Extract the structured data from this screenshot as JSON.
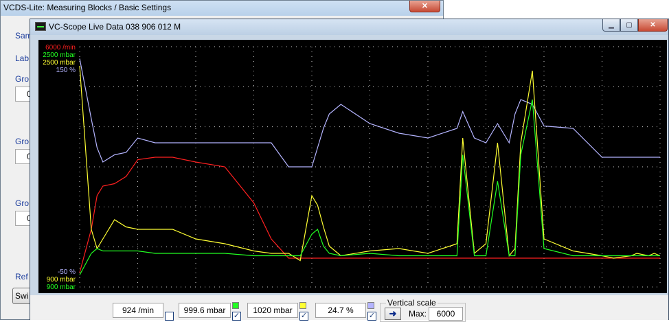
{
  "background_window": {
    "title": "VCDS-Lite: Measuring Blocks / Basic Settings",
    "close_label": "✕",
    "labels": [
      "Sam",
      "Lab",
      "Gro",
      "Gro",
      "Gro",
      "Ref"
    ],
    "boxes": [
      "0",
      "0",
      "0"
    ],
    "switch_button": "Swi"
  },
  "scope_window": {
    "title": "VC-Scope   Live Data   038 906 012 M",
    "minimize": "▁",
    "maximize": "▢",
    "close": "✕"
  },
  "chart_data": {
    "type": "line",
    "background": "#000000",
    "grid": true,
    "grid_color": "#c8c8c8",
    "y_scale_top": [
      {
        "text": "6000 /min",
        "color": "#ff2020"
      },
      {
        "text": "2500 mbar",
        "color": "#22ff22"
      },
      {
        "text": "2500 mbar",
        "color": "#ffff33"
      },
      {
        "text": "150 %",
        "color": "#b4b4ff"
      }
    ],
    "y_scale_bottom": [
      {
        "text": "-50 %",
        "color": "#b4b4ff"
      },
      {
        "text": "900 mbar",
        "color": "#ffff33"
      },
      {
        "text": "900 mbar",
        "color": "#22ff22"
      }
    ],
    "x": [
      0,
      2,
      3,
      4,
      6,
      8,
      10,
      13,
      16,
      20,
      25,
      30,
      33,
      36,
      38,
      40,
      41,
      42,
      43,
      45,
      50,
      55,
      60,
      65,
      66,
      68,
      70,
      72,
      74,
      75,
      76,
      78,
      80,
      85,
      90,
      92,
      95,
      96,
      98,
      99,
      100
    ],
    "series": [
      {
        "color": "#b4b4ff",
        "values": [
          95,
          70,
          58,
          52,
          55,
          56,
          62,
          60,
          60,
          60,
          60,
          60,
          60,
          50,
          50,
          50,
          58,
          66,
          72,
          76,
          68,
          64,
          62,
          66,
          73,
          62,
          60,
          68,
          60,
          72,
          78,
          76,
          67,
          66,
          54,
          54,
          54,
          54,
          54,
          54,
          54
        ]
      },
      {
        "color": "#ff2020",
        "values": [
          6,
          24,
          38,
          42,
          43,
          46,
          53,
          54,
          54,
          52,
          50,
          35,
          20,
          12,
          12,
          12,
          12,
          12,
          12,
          12,
          12,
          12,
          12,
          12,
          12,
          12,
          12,
          12,
          12,
          12,
          12,
          12,
          12,
          12,
          12,
          12,
          12,
          12,
          12,
          12,
          12
        ]
      },
      {
        "color": "#ffff33",
        "values": [
          92,
          24,
          16,
          20,
          28,
          25,
          24,
          24,
          24,
          20,
          18,
          15,
          14,
          14,
          11,
          38,
          34,
          25,
          17,
          13,
          15,
          16,
          14,
          18,
          62,
          14,
          18,
          60,
          13,
          16,
          60,
          90,
          20,
          15,
          13,
          12,
          13,
          14,
          13,
          14,
          13
        ]
      },
      {
        "color": "#22ff22",
        "values": [
          5,
          14,
          16,
          15,
          15,
          15,
          15,
          14,
          14,
          14,
          14,
          13,
          13,
          13,
          13,
          22,
          24,
          17,
          14,
          13,
          14,
          13,
          13,
          13,
          55,
          13,
          13,
          44,
          13,
          13,
          55,
          78,
          16,
          13,
          13,
          13,
          13,
          13,
          13,
          13,
          13
        ]
      }
    ]
  },
  "controls": {
    "rpm_value": "924 /min",
    "pressure1_value": "999.6 mbar",
    "pressure2_value": "1020 mbar",
    "percent_value": "24.7 %",
    "vertical_scale_label": "Vertical scale",
    "arrow": "➜",
    "max_label": "Max:",
    "max_value": "6000",
    "check": "✓",
    "swatch_colors": [
      "#22ff22",
      "#ffff33",
      "#b4b4ff"
    ]
  }
}
